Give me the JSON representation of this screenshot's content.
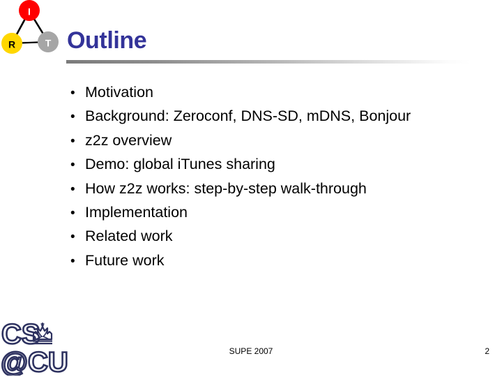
{
  "slide": {
    "title": "Outline",
    "title_color": "#333399",
    "background_color": "#ffffff",
    "text_color": "#000000"
  },
  "irt_logo": {
    "name": "irt-triangle-logo",
    "nodes": [
      {
        "label": "I",
        "color": "#ff0000",
        "label_color": "#ffffff"
      },
      {
        "label": "R",
        "color": "#ffd700",
        "label_color": "#000000"
      },
      {
        "label": "T",
        "color": "#a6a6a6",
        "label_color": "#ffffff"
      }
    ],
    "edge_color": "#000000"
  },
  "bullets": {
    "marker": "•",
    "items": [
      {
        "text": "Motivation"
      },
      {
        "text": "Background: Zeroconf, DNS-SD, mDNS, Bonjour"
      },
      {
        "text": "z2z overview"
      },
      {
        "text": "Demo: global iTunes sharing"
      },
      {
        "text": "How z2z works: step-by-step walk-through"
      },
      {
        "text": "Implementation"
      },
      {
        "text": "Related work"
      },
      {
        "text": "Future work"
      }
    ]
  },
  "cscu_logo": {
    "name": "columbia-cs-at-cu-logo",
    "line1": "CS",
    "line2": "@CU",
    "color": "#2e3260"
  },
  "footer": {
    "center_text": "SUPE 2007",
    "page_number": "2"
  }
}
